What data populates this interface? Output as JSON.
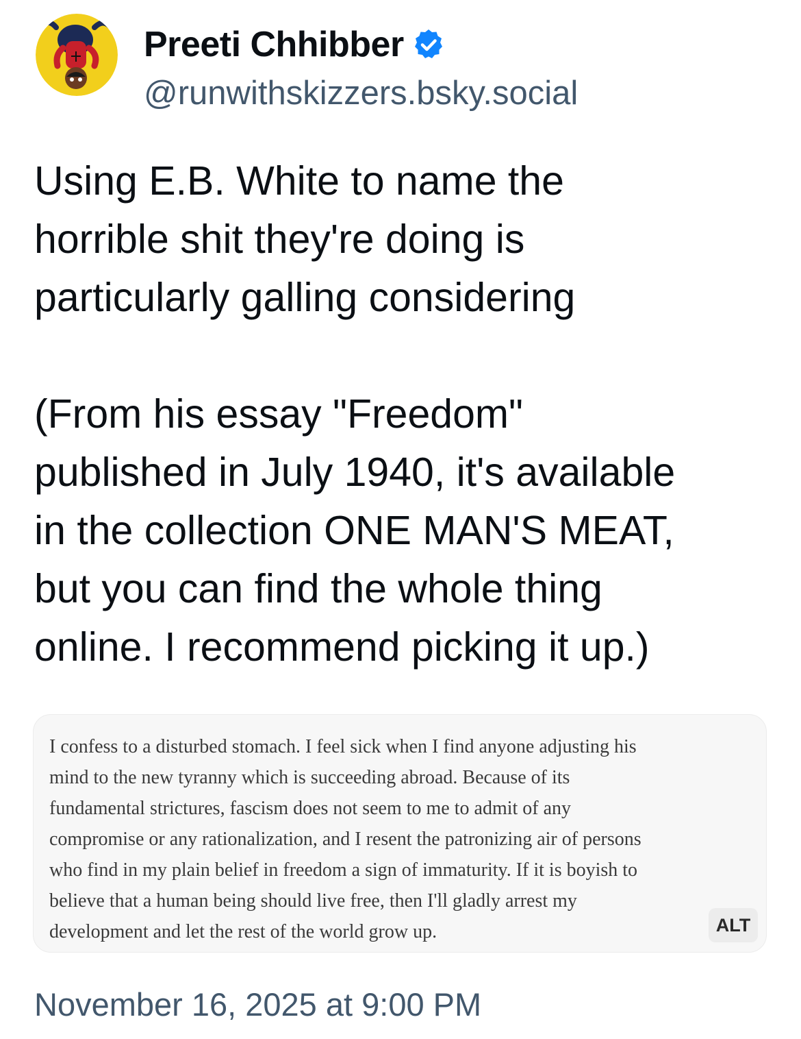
{
  "post": {
    "author": {
      "display_name": "Preeti Chhibber",
      "handle": "@runwithskizzers.bsky.social",
      "verified": true,
      "avatar_icon": "spider-man-avatar-icon",
      "verified_icon": "verified-checkmark-icon"
    },
    "text": "Using E.B. White to name the\nhorrible shit they're doing is\nparticularly galling considering\n\n(From his essay \"Freedom\"\npublished in July 1940, it's available\nin the collection ONE MAN'S MEAT,\nbut you can find the whole thing\nonline. I recommend picking it up.)",
    "image": {
      "quote_text": "I confess to a disturbed stomach. I feel sick when I find anyone adjusting his\nmind to the new tyranny which is succeeding abroad. Because of its\nfundamental strictures, fascism does not seem to me to admit of any\ncompromise or any rationalization, and I resent the patronizing air of persons\nwho find in my plain belief in freedom a sign of immaturity. If it is boyish to\nbelieve that a human being should live free, then I'll gladly arrest my\ndevelopment and let the rest of the world grow up.",
      "alt_label": "ALT"
    },
    "timestamp": "November 16, 2025 at 9:00 PM"
  },
  "colors": {
    "text_primary": "#0b0f14",
    "text_secondary": "#42576c",
    "verified_blue": "#1185fe",
    "card_background": "#f7f7f7"
  }
}
